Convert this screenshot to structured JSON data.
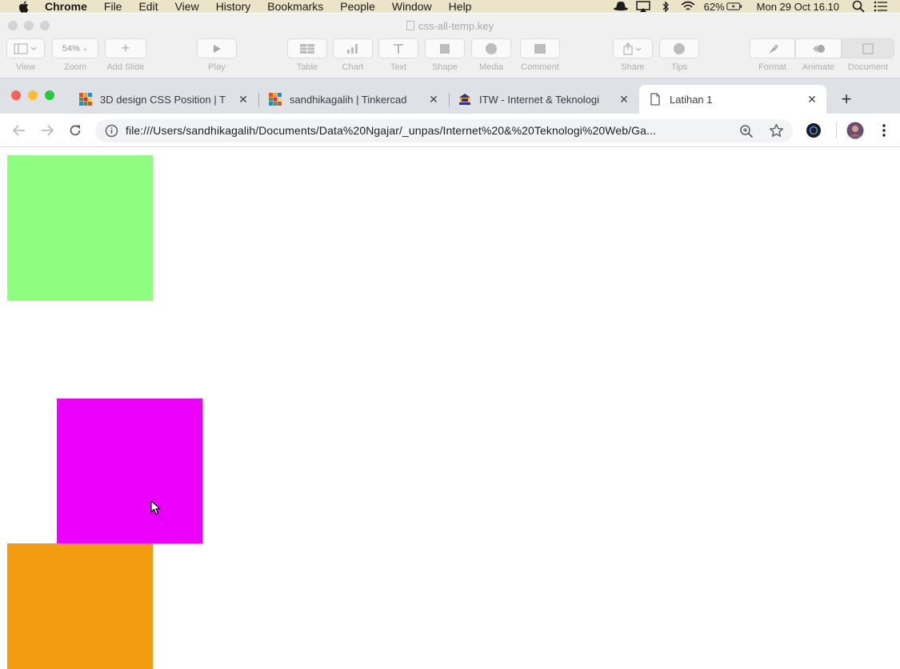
{
  "menubar": {
    "app": "Chrome",
    "items": [
      "File",
      "Edit",
      "View",
      "History",
      "Bookmarks",
      "People",
      "Window",
      "Help"
    ],
    "battery": "62%",
    "clock": "Mon 29 Oct  16.10"
  },
  "keynote": {
    "doc_title": "css-all-temp.key",
    "zoom_value": "54%",
    "buttons": [
      "View",
      "Zoom",
      "Add Slide",
      "Play",
      "Table",
      "Chart",
      "Text",
      "Shape",
      "Media",
      "Comment",
      "Share",
      "Tips",
      "Format",
      "Animate",
      "Document"
    ]
  },
  "tabs": [
    {
      "title": "3D design CSS Position | T",
      "icon": "tinkercad-icon"
    },
    {
      "title": "sandhikagalih | Tinkercad",
      "icon": "tinkercad-icon"
    },
    {
      "title": "ITW - Internet & Teknologi",
      "icon": "unpas-logo-icon"
    },
    {
      "title": "Latihan 1",
      "icon": "page-icon",
      "active": true
    }
  ],
  "address": {
    "url": "file:///Users/sandhikagalih/Documents/Data%20Ngajar/_unpas/Internet%20&%20Teknologi%20Web/Ga..."
  },
  "page": {
    "boxes": [
      {
        "name": "green",
        "color": "#8efd80"
      },
      {
        "name": "magenta",
        "color": "#ea00fb"
      },
      {
        "name": "orange",
        "color": "#f39c12"
      }
    ]
  },
  "colors": {
    "red_light": "#fe5f57",
    "yellow_light": "#febc2e",
    "green_light": "#28c840"
  }
}
